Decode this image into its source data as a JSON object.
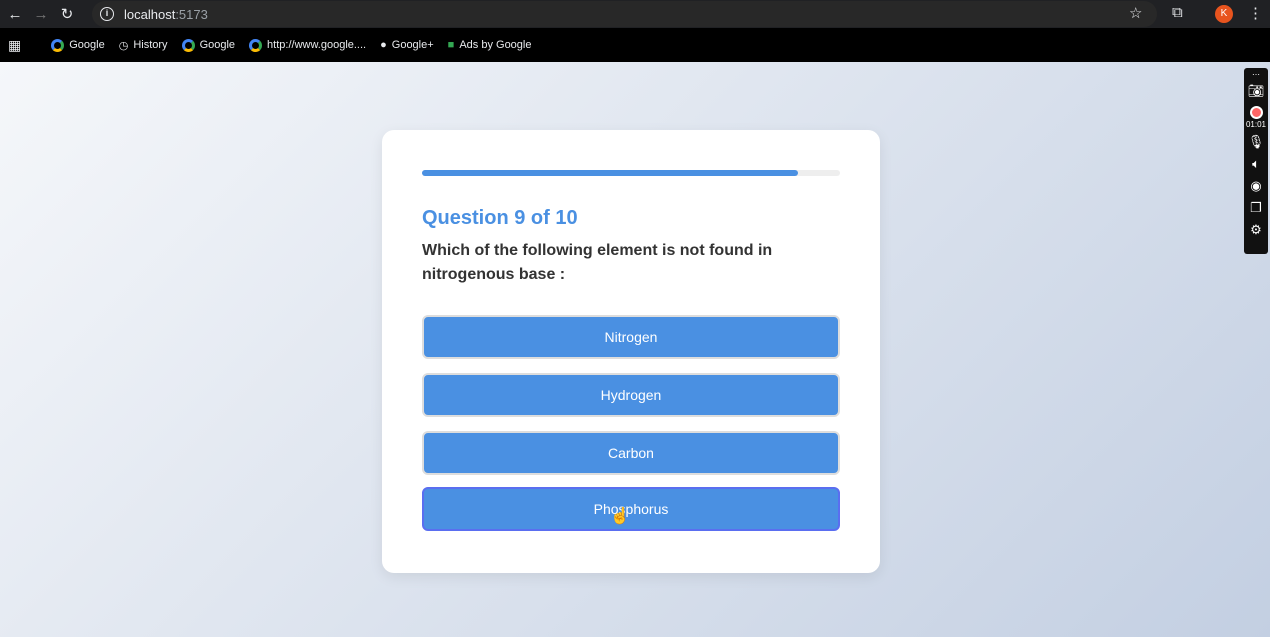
{
  "browser": {
    "url_host": "localhost",
    "url_port": ":5173",
    "avatar_letter": "K"
  },
  "bookmarks": [
    "Google",
    "History",
    "Google",
    "http://www.google....",
    "Google+",
    "Ads by Google"
  ],
  "recorder": {
    "timer": "01:01"
  },
  "quiz": {
    "progress": 0.9,
    "question_label": "Question 9 of 10",
    "question": "Which of the following element is not found in nitrogenous base :",
    "options": [
      "Nitrogen",
      "Hydrogen",
      "Carbon",
      "Phosphorus"
    ]
  }
}
